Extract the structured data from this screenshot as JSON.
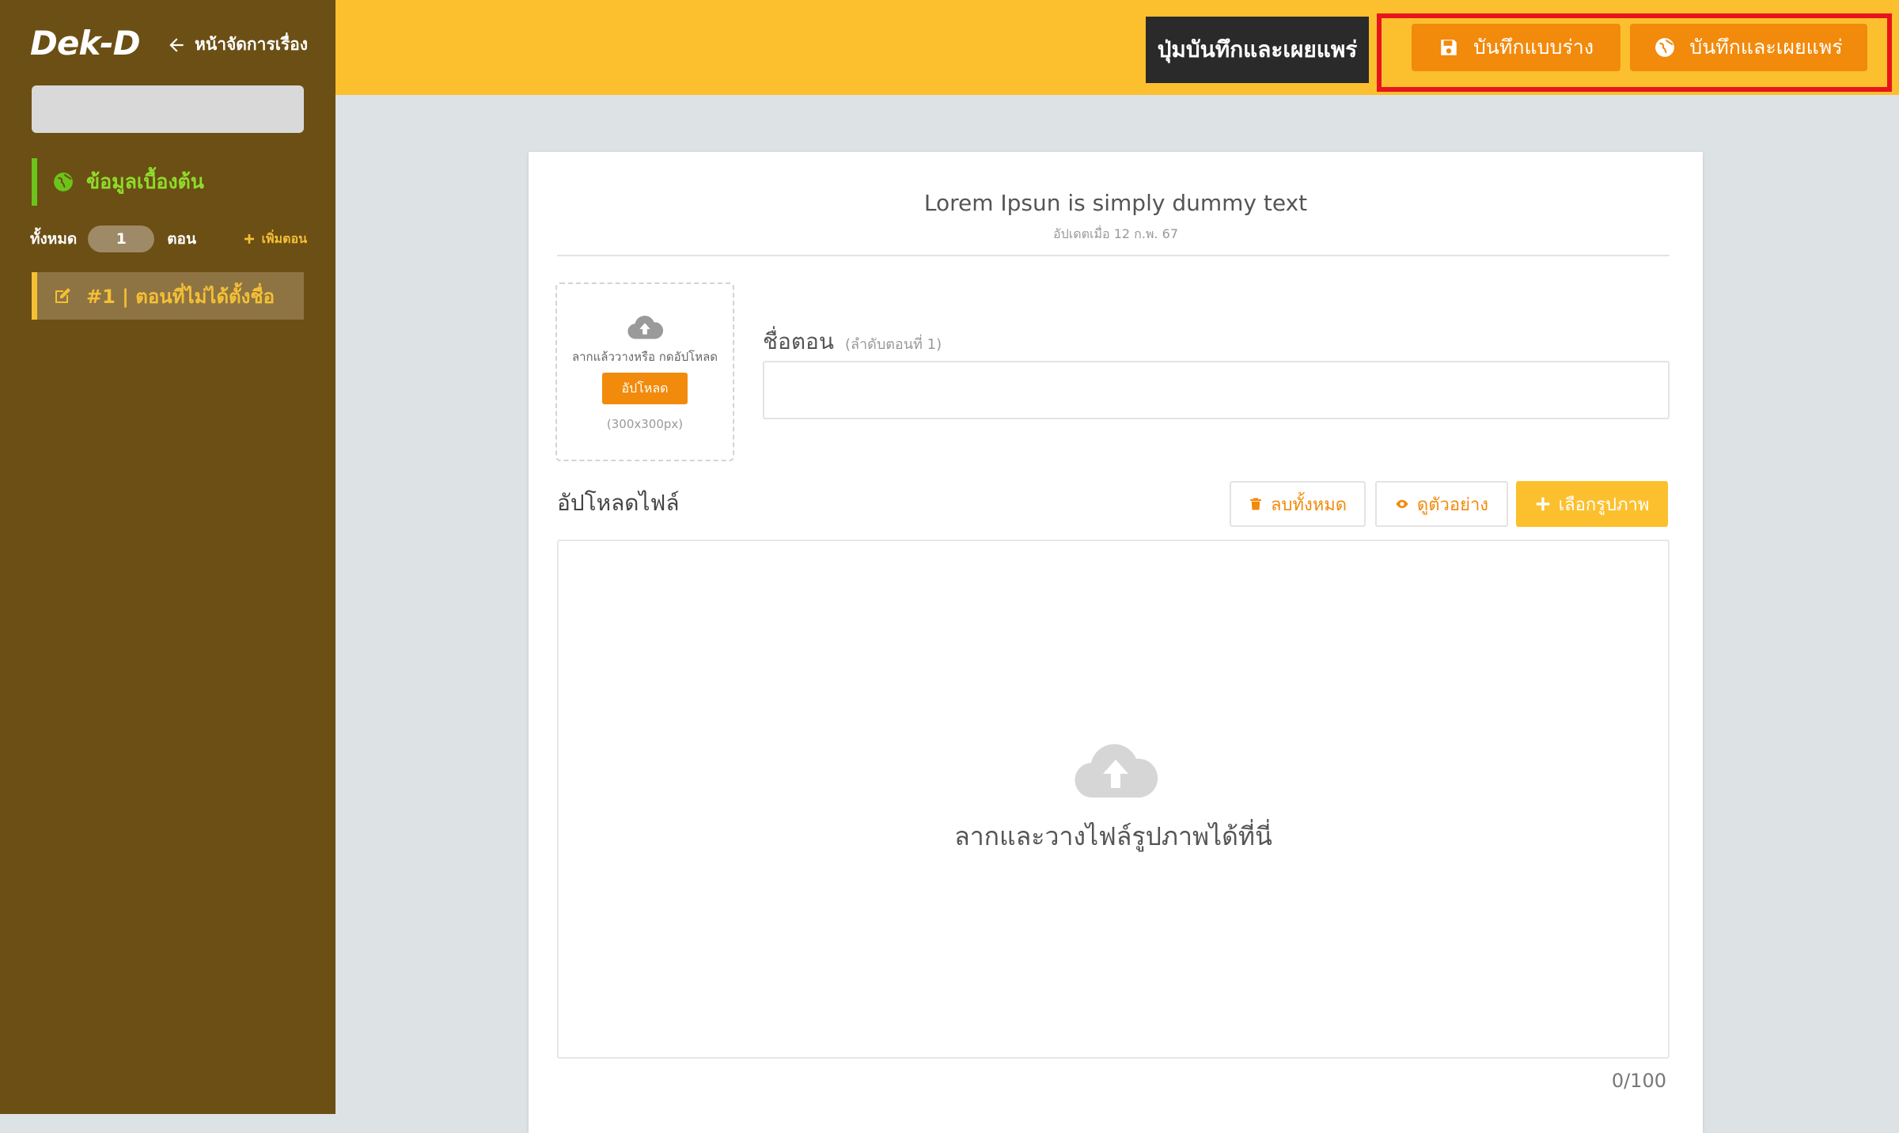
{
  "sidebar": {
    "logo": "Dek-D",
    "back_label": "หน้าจัดการเรื่อง",
    "basic_info_label": "ข้อมูลเบื้องต้น",
    "total_label": "ทั้งหมด",
    "chapter_count": "1",
    "chapter_unit": "ตอน",
    "add_chapter_label": "เพิ่มตอน",
    "chapter_item_label": "#1 | ตอนที่ไม่ได้ตั้งชื่อ"
  },
  "topbar": {
    "annotation_label": "ปุ่มบันทึกและเผยแพร่",
    "save_draft_label": "บันทึกแบบร่าง",
    "save_publish_label": "บันทึกและเผยแพร่"
  },
  "story": {
    "title": "Lorem Ipsun is simply dummy text",
    "updated": "อัปเดตเมื่อ 12 ก.พ. 67"
  },
  "cover": {
    "hint": "ลากแล้ววางหรือ กดอัปโหลด",
    "button_label": "อัปโหลด",
    "size_hint": "(300x300px)"
  },
  "chapter_form": {
    "name_label": "ชื่อตอน",
    "name_sub": "(ลำดับตอนที่ 1)",
    "name_value": ""
  },
  "upload": {
    "title": "อัปโหลดไฟล์",
    "delete_all_label": "ลบทั้งหมด",
    "preview_label": "ดูตัวอย่าง",
    "choose_label": "เลือกรูปภาพ",
    "drop_hint": "ลากและวางไฟล์รูปภาพได้ที่นี่",
    "file_count": "0/100"
  },
  "colors": {
    "sidebar_bg": "#6b4f14",
    "topbar_bg": "#fcc02e",
    "accent_orange": "#f28a0c",
    "highlight_red": "#e8141c",
    "green": "#8fdc2b"
  }
}
